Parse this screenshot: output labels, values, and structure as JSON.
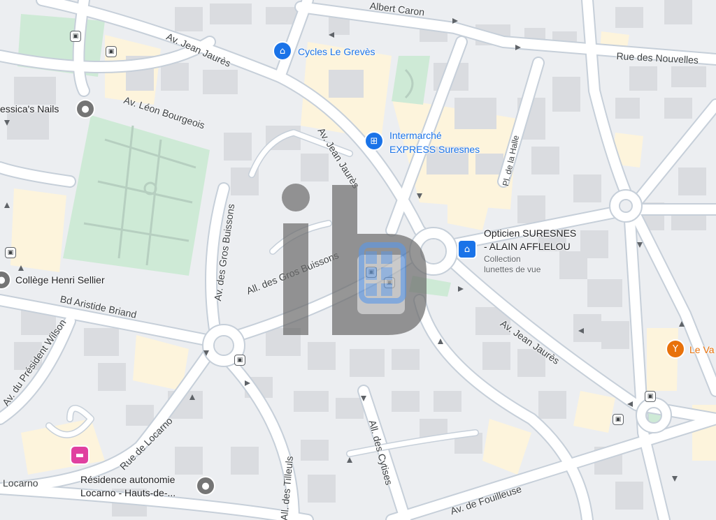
{
  "map": {
    "streets": [
      {
        "id": "jean-jaures-top",
        "label": "Av. Jean Jaurès"
      },
      {
        "id": "albert-caron",
        "label": "Albert Caron"
      },
      {
        "id": "nouvelles",
        "label": "Rue des Nouvelles"
      },
      {
        "id": "leon-bourgeois",
        "label": "Av. Léon Bourgeois"
      },
      {
        "id": "jean-jaures-mid",
        "label": "Av. Jean Jaurès"
      },
      {
        "id": "pl-halle",
        "label": "Pl. de la Halle"
      },
      {
        "id": "gros-buissons-av",
        "label": "Av. des Gros Buissons"
      },
      {
        "id": "gros-buissons-all",
        "label": "All. des Gros Buissons"
      },
      {
        "id": "aristide-briand",
        "label": "Bd Aristide Briand"
      },
      {
        "id": "jean-jaures-low",
        "label": "Av. Jean Jaurès"
      },
      {
        "id": "president-wilson",
        "label": "Av. du Président Wilson"
      },
      {
        "id": "locarno-rue",
        "label": "Rue de Locarno"
      },
      {
        "id": "locarno",
        "label": "Locarno"
      },
      {
        "id": "tilleuls",
        "label": "All. des Tilleuls"
      },
      {
        "id": "cytises",
        "label": "All. des Cytises"
      },
      {
        "id": "fouilleuse",
        "label": "Av. de Fouilleuse"
      }
    ],
    "pois": [
      {
        "id": "cycles",
        "name": "Cycles Le Grevès",
        "icon": "shopping-bag-icon",
        "color": "#1a73e8"
      },
      {
        "id": "intermarche",
        "name_line1": "Intermarché",
        "name_line2": "EXPRESS Suresnes",
        "icon": "shopping-cart-icon",
        "color": "#1a73e8"
      },
      {
        "id": "opticien",
        "name_line1": "Opticien SURESNES",
        "name_line2": "- ALAIN AFFLELOU",
        "sub_line1": "Collection",
        "sub_line2": "lunettes de vue",
        "icon": "shopping-bag-icon",
        "color": "#1a73e8"
      },
      {
        "id": "nails",
        "name": "essica's Nails",
        "icon": "pin-icon",
        "color": "#5f6368"
      },
      {
        "id": "college",
        "name": "Collège Henri Sellier",
        "icon": "pin-icon",
        "color": "#5f6368"
      },
      {
        "id": "residence",
        "name_line1": "Résidence autonomie",
        "name_line2": "Locarno -  Hauts-de-...",
        "icon": "pin-icon",
        "color": "#5f6368"
      },
      {
        "id": "bar",
        "name": "Le Va",
        "icon": "cocktail-icon",
        "color": "#e8710a"
      },
      {
        "id": "hotel",
        "icon": "bed-icon",
        "color": "#e040a0"
      }
    ],
    "colors": {
      "background": "#e8eaed",
      "block": "#f1f3f4",
      "building": "#dadce0",
      "road": "#ffffff",
      "road_edge": "#c6cfd9",
      "park": "#ceead6",
      "commercial": "#fef7e0",
      "watermark": "#6b6b6b",
      "watermark_accent": "#1a73e8"
    }
  }
}
